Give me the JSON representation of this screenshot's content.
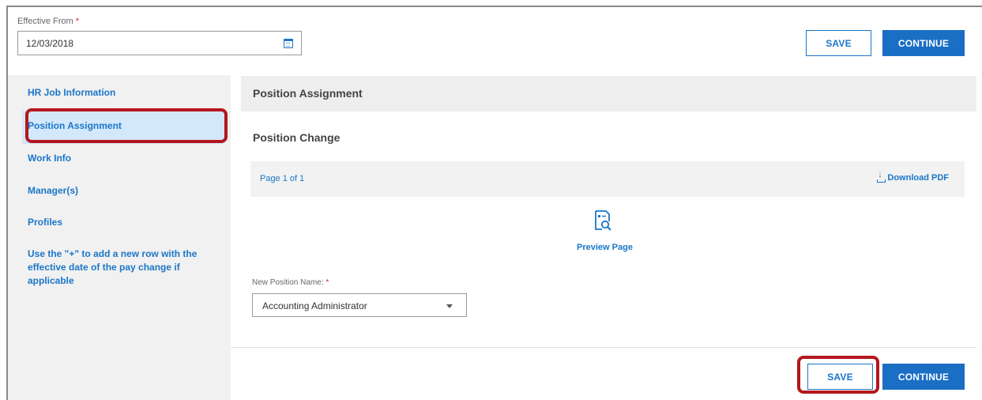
{
  "effective_from": {
    "label": "Effective From",
    "required_mark": "*",
    "value": "12/03/2018",
    "icon": "calendar-icon"
  },
  "actions": {
    "save_label": "SAVE",
    "continue_label": "CONTINUE"
  },
  "sidebar": {
    "items": [
      {
        "label": "HR Job Information"
      },
      {
        "label": "Position Assignment",
        "active": true
      },
      {
        "label": "Work Info"
      },
      {
        "label": "Manager(s)"
      },
      {
        "label": "Profiles"
      }
    ],
    "note": "Use the \"+\" to add a new row with the effective date of the pay change if applicable"
  },
  "main": {
    "section_title": "Position Assignment",
    "subsection_title": "Position Change",
    "document": {
      "page_indicator": "Page 1 of 1",
      "download_label": "Download PDF",
      "preview_label": "Preview Page"
    },
    "new_position": {
      "label": "New Position Name:",
      "required_mark": "*",
      "value": "Accounting Administrator"
    }
  },
  "colors": {
    "accent": "#1b76c8",
    "primary_button": "#1a6ec4",
    "highlight_ring": "#b3171d",
    "active_item_bg": "#d3e8fa",
    "required": "#d9242e"
  }
}
